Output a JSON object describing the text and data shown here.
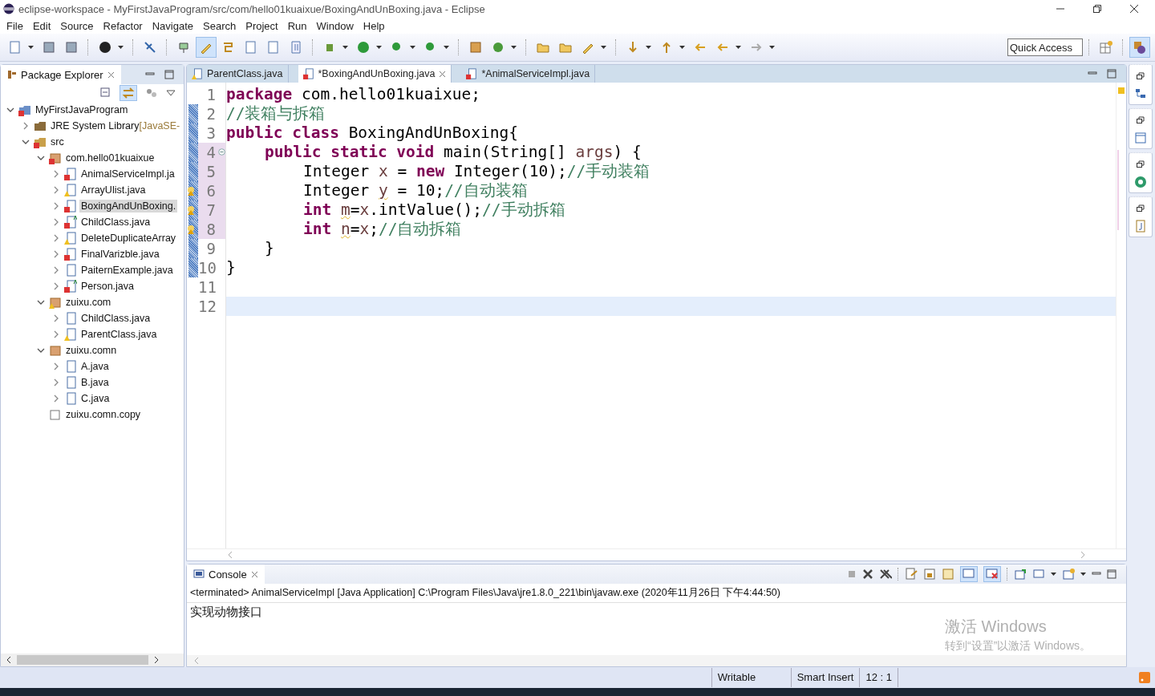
{
  "window": {
    "title": "eclipse-workspace - MyFirstJavaProgram/src/com/hello01kuaixue/BoxingAndUnBoxing.java - Eclipse"
  },
  "menu": [
    "File",
    "Edit",
    "Source",
    "Refactor",
    "Navigate",
    "Search",
    "Project",
    "Run",
    "Window",
    "Help"
  ],
  "toolbar": [
    {
      "kind": "new",
      "pressed": false,
      "dropdown": true
    },
    {
      "kind": "save",
      "pressed": false
    },
    {
      "kind": "saveall",
      "pressed": false
    },
    {
      "kind": "sep"
    },
    {
      "kind": "person",
      "pressed": false,
      "dropdown": true
    },
    {
      "kind": "sep"
    },
    {
      "kind": "skip",
      "pressed": false
    },
    {
      "kind": "sep"
    },
    {
      "kind": "pin",
      "pressed": false
    },
    {
      "kind": "pen",
      "pressed": true
    },
    {
      "kind": "steps",
      "pressed": false
    },
    {
      "kind": "doc",
      "pressed": false
    },
    {
      "kind": "doc",
      "pressed": false
    },
    {
      "kind": "para",
      "pressed": false
    },
    {
      "kind": "sep"
    },
    {
      "kind": "bug",
      "pressed": false,
      "dropdown": true
    },
    {
      "kind": "run",
      "pressed": false,
      "dropdown": true
    },
    {
      "kind": "runext",
      "pressed": false,
      "dropdown": true
    },
    {
      "kind": "runext",
      "pressed": false,
      "dropdown": true
    },
    {
      "kind": "sep"
    },
    {
      "kind": "box",
      "pressed": false
    },
    {
      "kind": "cplus",
      "pressed": false,
      "dropdown": true
    },
    {
      "kind": "sep"
    },
    {
      "kind": "folder",
      "pressed": false
    },
    {
      "kind": "folder",
      "pressed": false
    },
    {
      "kind": "brush",
      "pressed": false,
      "dropdown": true
    },
    {
      "kind": "sep"
    },
    {
      "kind": "down",
      "pressed": false,
      "dropdown": true
    },
    {
      "kind": "up",
      "pressed": false,
      "dropdown": true
    },
    {
      "kind": "back",
      "pressed": false
    },
    {
      "kind": "left",
      "pressed": false,
      "dropdown": true
    },
    {
      "kind": "right",
      "pressed": false,
      "dropdown": true
    }
  ],
  "quick_access": {
    "placeholder": "Quick Access"
  },
  "package_explorer": {
    "title": "Package Explorer",
    "tree": [
      {
        "label": "MyFirstJavaProgram",
        "kind": "project",
        "error": true,
        "warning": false,
        "expanded": true,
        "selected": false,
        "children": [
          {
            "label": "JRE System Library",
            "suffix": "[JavaSE-",
            "kind": "library",
            "error": false,
            "warning": false,
            "expanded": false,
            "selected": false
          },
          {
            "label": "src",
            "kind": "srcfolder",
            "error": true,
            "warning": false,
            "expanded": true,
            "selected": false,
            "children": [
              {
                "label": "com.hello01kuaixue",
                "kind": "package",
                "error": true,
                "warning": false,
                "expanded": true,
                "selected": false,
                "children": [
                  {
                    "label": "AnimalServiceImpl.ja",
                    "kind": "java",
                    "error": true,
                    "warning": false,
                    "expanded": false,
                    "selected": false
                  },
                  {
                    "label": "ArrayUlist.java",
                    "kind": "java",
                    "error": false,
                    "warning": true,
                    "expanded": false,
                    "selected": false
                  },
                  {
                    "label": "BoxingAndUnBoxing.",
                    "kind": "java",
                    "error": true,
                    "warning": false,
                    "expanded": false,
                    "selected": true
                  },
                  {
                    "label": "ChildClass.java",
                    "kind": "javamain",
                    "error": true,
                    "warning": false,
                    "expanded": false,
                    "selected": false
                  },
                  {
                    "label": "DeleteDuplicateArray",
                    "kind": "java",
                    "error": false,
                    "warning": true,
                    "expanded": false,
                    "selected": false
                  },
                  {
                    "label": "FinalVarizble.java",
                    "kind": "java",
                    "error": true,
                    "warning": false,
                    "expanded": false,
                    "selected": false
                  },
                  {
                    "label": "PaiternExample.java",
                    "kind": "java",
                    "error": false,
                    "warning": false,
                    "expanded": false,
                    "selected": false
                  },
                  {
                    "label": "Person.java",
                    "kind": "javamain",
                    "error": true,
                    "warning": false,
                    "expanded": false,
                    "selected": false
                  }
                ]
              },
              {
                "label": "zuixu.com",
                "kind": "package",
                "error": false,
                "warning": true,
                "expanded": true,
                "selected": false,
                "children": [
                  {
                    "label": "ChildClass.java",
                    "kind": "java",
                    "error": false,
                    "warning": false,
                    "expanded": false,
                    "selected": false
                  },
                  {
                    "label": "ParentClass.java",
                    "kind": "java",
                    "error": false,
                    "warning": true,
                    "expanded": false,
                    "selected": false
                  }
                ]
              },
              {
                "label": "zuixu.comn",
                "kind": "package",
                "error": false,
                "warning": false,
                "expanded": true,
                "selected": false,
                "children": [
                  {
                    "label": "A.java",
                    "kind": "java",
                    "error": false,
                    "warning": false,
                    "expanded": false,
                    "selected": false
                  },
                  {
                    "label": "B.java",
                    "kind": "java",
                    "error": false,
                    "warning": false,
                    "expanded": false,
                    "selected": false
                  },
                  {
                    "label": "C.java",
                    "kind": "java",
                    "error": false,
                    "warning": false,
                    "expanded": false,
                    "selected": false
                  }
                ]
              },
              {
                "label": "zuixu.comn.copy",
                "kind": "emptypackage",
                "error": false,
                "warning": false,
                "selected": false
              }
            ]
          }
        ]
      }
    ]
  },
  "editor": {
    "tabs": [
      {
        "label": "ParentClass.java",
        "error": false,
        "warning": true,
        "selected": false
      },
      {
        "label": "*BoxingAndUnBoxing.java",
        "error": true,
        "warning": false,
        "selected": true
      },
      {
        "label": "*AnimalServiceImpl.java",
        "error": true,
        "warning": false,
        "selected": false
      }
    ],
    "lines": [
      {
        "number": "1",
        "kind": "top",
        "warning": false,
        "fold": false,
        "changed": false,
        "current": false,
        "tokens": [
          {
            "kind": "kw",
            "text": "package"
          },
          {
            "kind": "plain",
            "text": " com.hello01kuaixue;"
          }
        ]
      },
      {
        "number": "2",
        "kind": "top",
        "warning": false,
        "fold": false,
        "changed": true,
        "current": false,
        "tokens": [
          {
            "kind": "comment",
            "text": "//装箱与拆箱"
          }
        ]
      },
      {
        "number": "3",
        "kind": "top",
        "warning": false,
        "fold": false,
        "changed": true,
        "current": false,
        "tokens": [
          {
            "kind": "kw",
            "text": "public class"
          },
          {
            "kind": "plain",
            "text": " BoxingAndUnBoxing{"
          }
        ]
      },
      {
        "number": "4",
        "kind": "member",
        "warning": false,
        "fold": true,
        "changed": true,
        "current": false,
        "tokens": [
          {
            "kind": "kw",
            "text": "public static void"
          },
          {
            "kind": "plain",
            "text": " main(String[] "
          },
          {
            "kind": "var",
            "text": "args"
          },
          {
            "kind": "plain",
            "text": ") {"
          }
        ]
      },
      {
        "number": "5",
        "kind": "body",
        "warning": false,
        "fold": false,
        "changed": true,
        "current": false,
        "tokens": [
          {
            "kind": "plain",
            "text": "Integer "
          },
          {
            "kind": "var",
            "text": "x"
          },
          {
            "kind": "plain",
            "text": " = "
          },
          {
            "kind": "kw",
            "text": "new"
          },
          {
            "kind": "plain",
            "text": " Integer(10);"
          },
          {
            "kind": "comment",
            "text": "//手动装箱"
          }
        ]
      },
      {
        "number": "6",
        "kind": "body",
        "warning": true,
        "fold": false,
        "changed": true,
        "current": false,
        "tokens": [
          {
            "kind": "plain",
            "text": "Integer "
          },
          {
            "kind": "warnvar",
            "text": "y"
          },
          {
            "kind": "plain",
            "text": " = 10;"
          },
          {
            "kind": "comment",
            "text": "//自动装箱"
          }
        ]
      },
      {
        "number": "7",
        "kind": "body",
        "warning": true,
        "fold": false,
        "changed": true,
        "current": false,
        "tokens": [
          {
            "kind": "kw",
            "text": "int "
          },
          {
            "kind": "warnvar",
            "text": "m"
          },
          {
            "kind": "plain",
            "text": "="
          },
          {
            "kind": "var",
            "text": "x"
          },
          {
            "kind": "plain",
            "text": ".intValue();"
          },
          {
            "kind": "comment",
            "text": "//手动拆箱"
          }
        ]
      },
      {
        "number": "8",
        "kind": "body",
        "warning": true,
        "fold": false,
        "changed": true,
        "current": false,
        "tokens": [
          {
            "kind": "kw",
            "text": "int "
          },
          {
            "kind": "warnvar",
            "text": "n"
          },
          {
            "kind": "plain",
            "text": "="
          },
          {
            "kind": "var",
            "text": "x"
          },
          {
            "kind": "plain",
            "text": ";"
          },
          {
            "kind": "comment",
            "text": "//自动拆箱"
          }
        ]
      },
      {
        "number": "9",
        "kind": "member",
        "warning": false,
        "fold": false,
        "changed": true,
        "current": false,
        "tokens": [
          {
            "kind": "plain",
            "text": "}"
          }
        ]
      },
      {
        "number": "10",
        "kind": "top",
        "warning": false,
        "fold": false,
        "changed": true,
        "current": false,
        "tokens": [
          {
            "kind": "plain",
            "text": "}"
          }
        ]
      },
      {
        "number": "11",
        "kind": "top",
        "warning": false,
        "fold": false,
        "changed": false,
        "current": false
      },
      {
        "number": "12",
        "kind": "top",
        "warning": false,
        "fold": false,
        "changed": false,
        "current": true
      }
    ]
  },
  "console": {
    "title": "Console",
    "status": "<terminated> AnimalServiceImpl [Java Application] C:\\Program Files\\Java\\jre1.8.0_221\\bin\\javaw.exe (2020年11月26日 下午4:44:50)",
    "output": "实现动物接口"
  },
  "activation_notice": {
    "title": "激活 Windows",
    "message": "转到“设置”以激活 Windows。"
  },
  "status_bar": [
    "Writable",
    "Smart Insert",
    "12 : 1"
  ]
}
